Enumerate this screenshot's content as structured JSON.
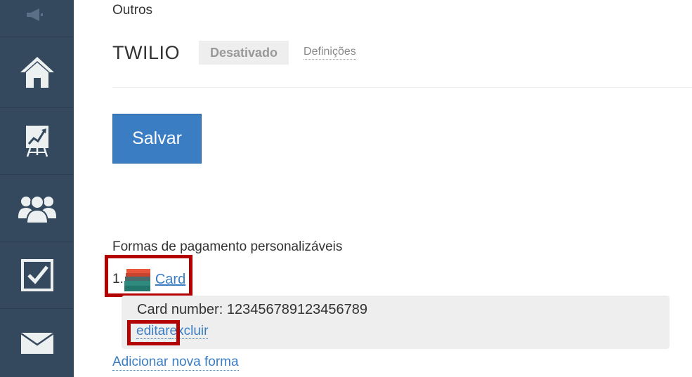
{
  "sidebar": {
    "items": [
      {
        "icon": "megaphone-icon"
      },
      {
        "icon": "home-icon"
      },
      {
        "icon": "chart-icon"
      },
      {
        "icon": "users-icon"
      },
      {
        "icon": "checkbox-icon"
      },
      {
        "icon": "mail-icon"
      }
    ],
    "background": "#34495e"
  },
  "section": {
    "title": "Outros"
  },
  "twilio": {
    "name": "TWILIO",
    "status": "Desativado",
    "settings_label": "Definições"
  },
  "actions": {
    "save_label": "Salvar"
  },
  "payment_methods": {
    "heading": "Formas de pagamento personalizáveis",
    "items": [
      {
        "index": "1.",
        "icon": "card-stack-icon",
        "name": "Card",
        "detail": "Card number: 123456789123456789",
        "edit_label": "editar",
        "delete_label": "excluir"
      }
    ],
    "add_label": "Adicionar nova forma"
  },
  "colors": {
    "accent": "#3a7dc2",
    "highlight": "#b30000"
  }
}
